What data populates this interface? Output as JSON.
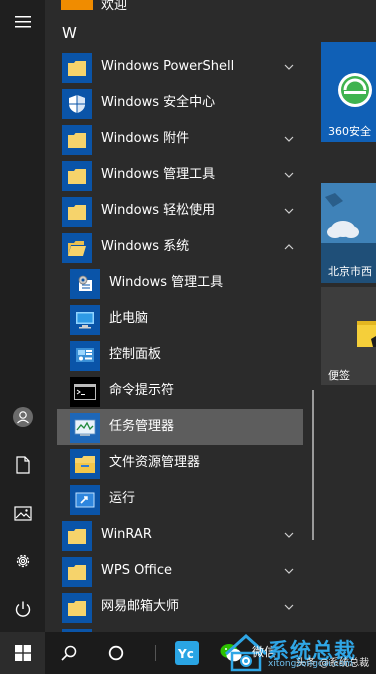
{
  "app_list": {
    "letter_header": "W",
    "top_stub_label": "欢迎",
    "items": [
      {
        "label": "Windows PowerShell",
        "icon": "folder-icon",
        "expandable": true
      },
      {
        "label": "Windows 安全中心",
        "icon": "shield-icon",
        "expandable": false
      },
      {
        "label": "Windows 附件",
        "icon": "folder-icon",
        "expandable": true
      },
      {
        "label": "Windows 管理工具",
        "icon": "folder-icon",
        "expandable": true
      },
      {
        "label": "Windows 轻松使用",
        "icon": "folder-icon",
        "expandable": true
      },
      {
        "label": "Windows 系统",
        "icon": "folder-open-icon",
        "expandable": true,
        "expanded": true
      },
      {
        "label": "Windows 管理工具",
        "icon": "admin-tools-icon",
        "sub": true
      },
      {
        "label": "此电脑",
        "icon": "this-pc-icon",
        "sub": true
      },
      {
        "label": "控制面板",
        "icon": "control-panel-icon",
        "sub": true
      },
      {
        "label": "命令提示符",
        "icon": "command-prompt-icon",
        "sub": true
      },
      {
        "label": "任务管理器",
        "icon": "task-manager-icon",
        "sub": true,
        "selected": true
      },
      {
        "label": "文件资源管理器",
        "icon": "file-explorer-icon",
        "sub": true
      },
      {
        "label": "运行",
        "icon": "run-icon",
        "sub": true
      },
      {
        "label": "WinRAR",
        "icon": "folder-icon",
        "expandable": true
      },
      {
        "label": "WPS Office",
        "icon": "folder-icon",
        "expandable": true
      },
      {
        "label": "网易邮箱大师",
        "icon": "folder-icon",
        "expandable": true
      }
    ]
  },
  "tiles": {
    "security_label": "360安全",
    "weather_label": "北京市西",
    "sticky_label": "便签"
  },
  "taskbar": {
    "wechat_label": "微信",
    "watermark_title": "系统总裁",
    "watermark_url": "xitongzongcai.com",
    "watermark_credit": "头条 @系统总裁"
  },
  "colors": {
    "accent": "#0a54a8",
    "folder_yellow": "#f6d36b",
    "selected_row": "#5d5d5d",
    "watermark_blue": "#2fa6e6"
  }
}
